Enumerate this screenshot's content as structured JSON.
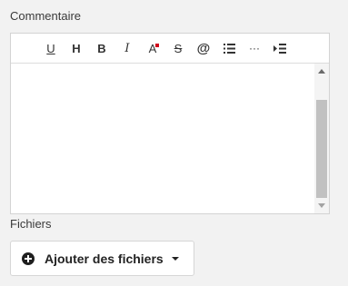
{
  "comment": {
    "label": "Commentaire",
    "toolbar": {
      "underline": "U",
      "heading": "H",
      "bold": "B",
      "italic": "I",
      "font_color": "A",
      "strikethrough": "S",
      "mention": "@",
      "bullet_list": "bullet-list-icon",
      "more": "···",
      "indent": "indent-icon"
    },
    "value": ""
  },
  "files": {
    "label": "Fichiers",
    "add_button_label": "Ajouter des fichiers"
  },
  "colors": {
    "background": "#f2f2f2",
    "font_color_indicator": "#d0021b"
  }
}
